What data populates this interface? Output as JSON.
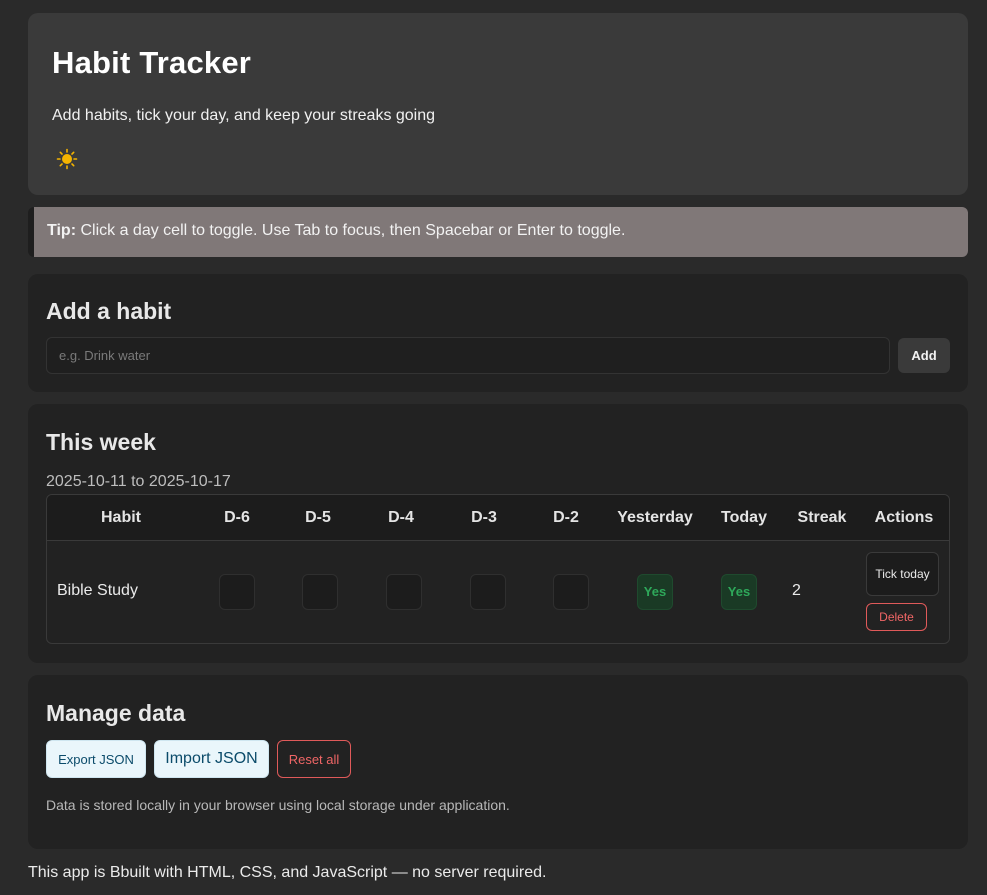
{
  "header": {
    "title": "Habit Tracker",
    "subtitle": "Add habits, tick your day, and keep your streaks going",
    "theme_icon": "sun-icon"
  },
  "tip": {
    "label": "Tip:",
    "text": " Click a day cell to toggle. Use Tab to focus, then Spacebar or Enter to toggle."
  },
  "add_habit": {
    "heading": "Add a habit",
    "placeholder": "e.g. Drink water",
    "value": "",
    "button": "Add"
  },
  "week": {
    "heading": "This week",
    "range": "2025-10-11 to 2025-10-17",
    "columns": [
      "Habit",
      "D-6",
      "D-5",
      "D-4",
      "D-3",
      "D-2",
      "Yesterday",
      "Today",
      "Streak",
      "Actions"
    ],
    "rows": [
      {
        "habit": "Bible Study",
        "days": [
          "",
          "",
          "",
          "",
          "",
          "Yes",
          "Yes"
        ],
        "streak": "2",
        "tick_label": "Tick today",
        "delete_label": "Delete"
      }
    ]
  },
  "manage": {
    "heading": "Manage data",
    "export_label": "Export JSON",
    "import_label": "Import JSON",
    "reset_label": "Reset all",
    "note": "Data is stored locally in your browser using local storage under application."
  },
  "footer": {
    "text": "This app is Bbuilt with HTML, CSS, and JavaScript — no server required."
  },
  "colors": {
    "background": "#2a2a2a",
    "card": "#222222",
    "header": "#3a3a3a",
    "tip": "#807878",
    "done": "#1a3a25",
    "done_text": "#2ea85a",
    "danger": "#f06666",
    "info_bg": "#eaf6fb"
  }
}
